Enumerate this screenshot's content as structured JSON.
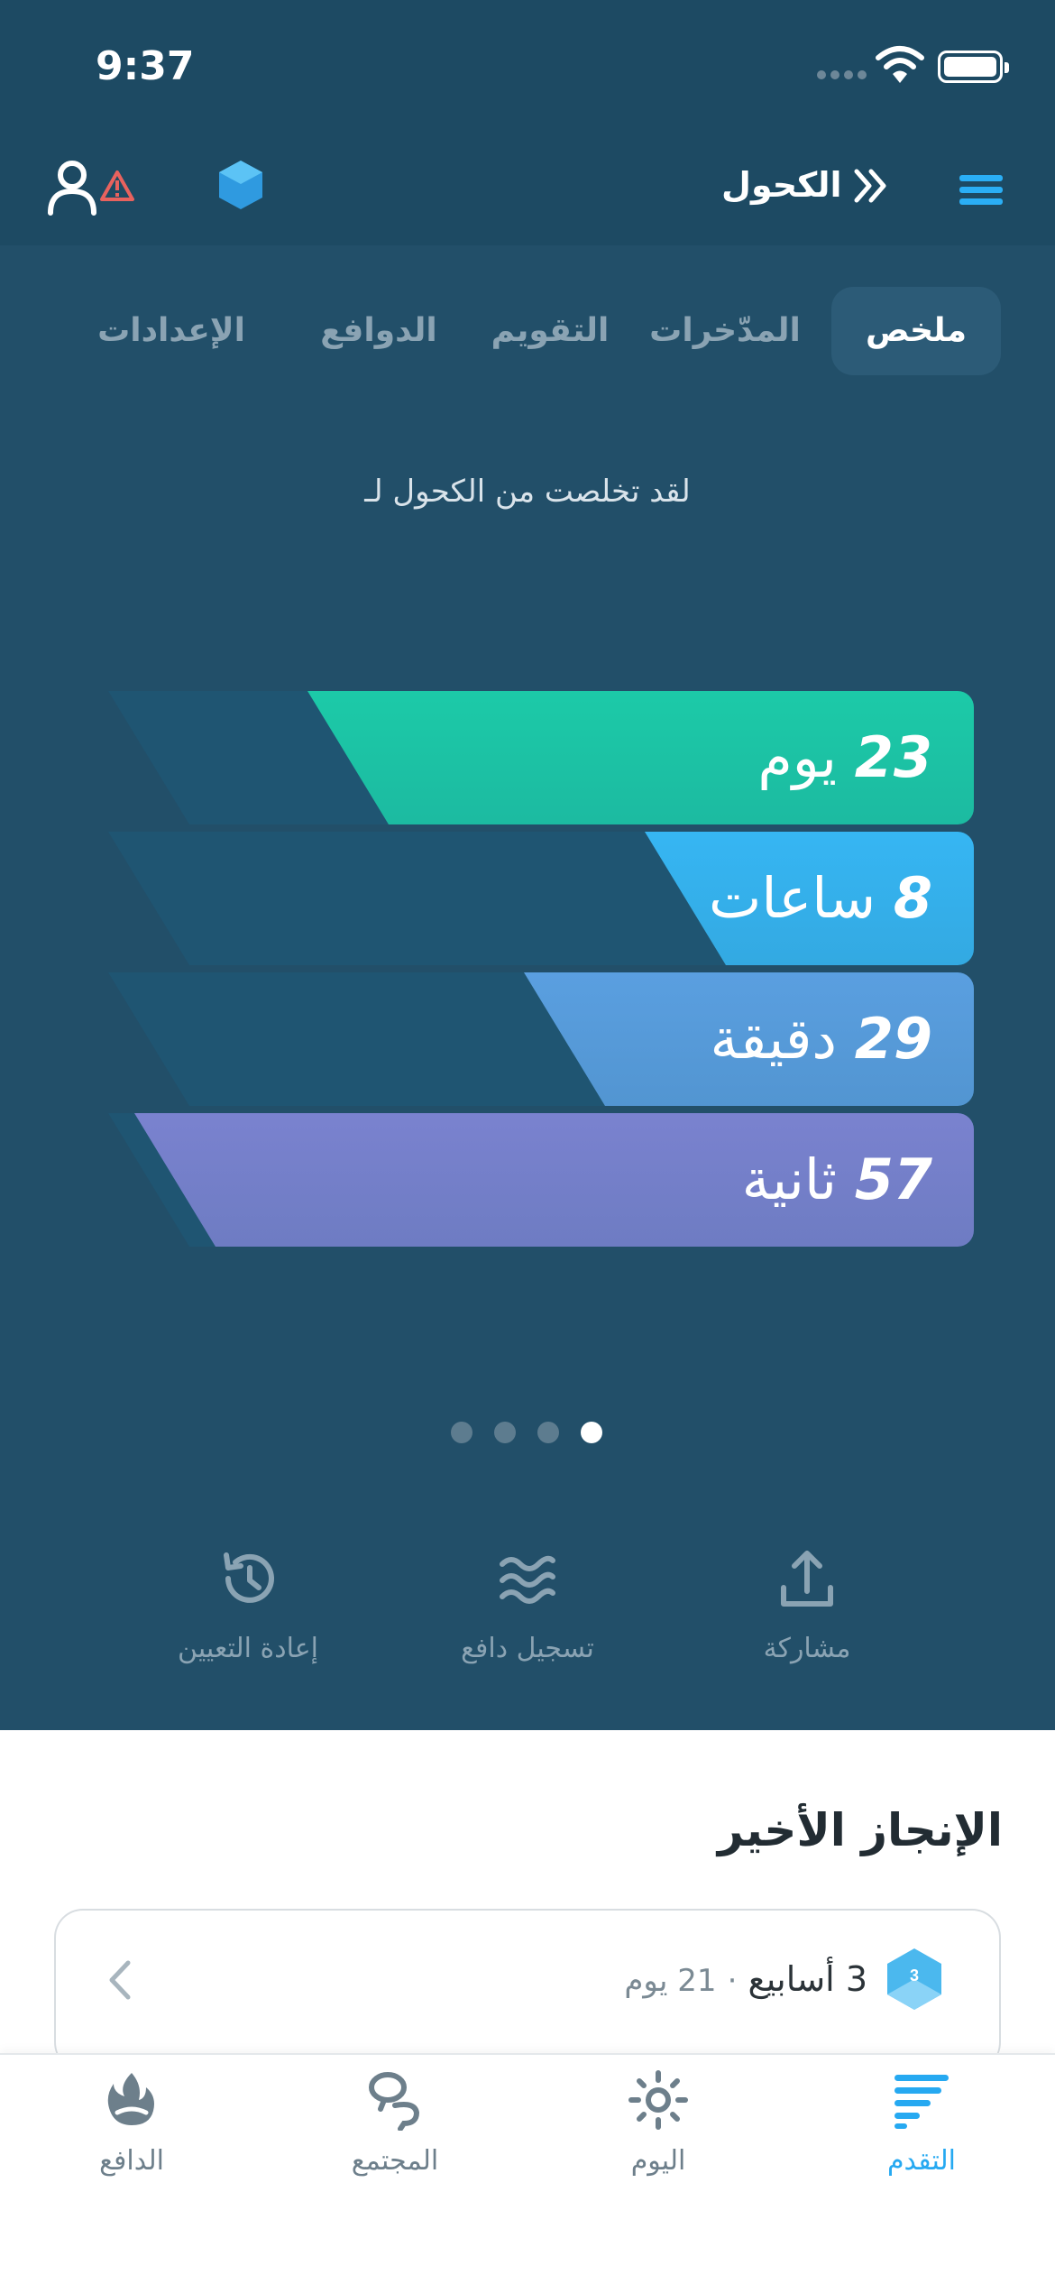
{
  "status_bar": {
    "time": "9:37"
  },
  "header": {
    "title": "الكحول"
  },
  "tabs": [
    {
      "label": "ملخص",
      "active": true
    },
    {
      "label": "المدّخرات",
      "active": false
    },
    {
      "label": "التقويم",
      "active": false
    },
    {
      "label": "الدوافع",
      "active": false
    },
    {
      "label": "الإعدادات",
      "active": false
    }
  ],
  "summary": {
    "subtitle": "لقد تخلصت من الكحول لـ",
    "counters": [
      {
        "value": "23",
        "unit": "يوم",
        "fill_fraction": 0.77,
        "color": "#1ccaa8"
      },
      {
        "value": "8",
        "unit": "ساعات",
        "fill_fraction": 0.38,
        "color": "#36b6f3"
      },
      {
        "value": "29",
        "unit": "دقيقة",
        "fill_fraction": 0.52,
        "color": "#5a9fe0"
      },
      {
        "value": "57",
        "unit": "ثانية",
        "fill_fraction": 0.97,
        "color": "#7a82cf"
      }
    ],
    "page_dots": {
      "count": 4,
      "active_index": 3
    }
  },
  "actions": [
    {
      "label": "مشاركة",
      "icon": "share-icon"
    },
    {
      "label": "تسجيل دافع",
      "icon": "waves-icon"
    },
    {
      "label": "إعادة التعيين",
      "icon": "history-icon"
    }
  ],
  "recent": {
    "title": "الإنجاز الأخير",
    "badge": "3",
    "primary": "3 أسابيع",
    "separator": "·",
    "secondary": "21 يوم"
  },
  "tabbar": [
    {
      "label": "التقدم",
      "icon": "progress-icon",
      "active": true
    },
    {
      "label": "اليوم",
      "icon": "sun-icon",
      "active": false
    },
    {
      "label": "المجتمع",
      "icon": "community-icon",
      "active": false
    },
    {
      "label": "الدافع",
      "icon": "motivation-icon",
      "active": false
    }
  ],
  "colors": {
    "header_bg": "#1d4a63",
    "body_bg": "#224f69",
    "accent": "#26a9f1"
  }
}
